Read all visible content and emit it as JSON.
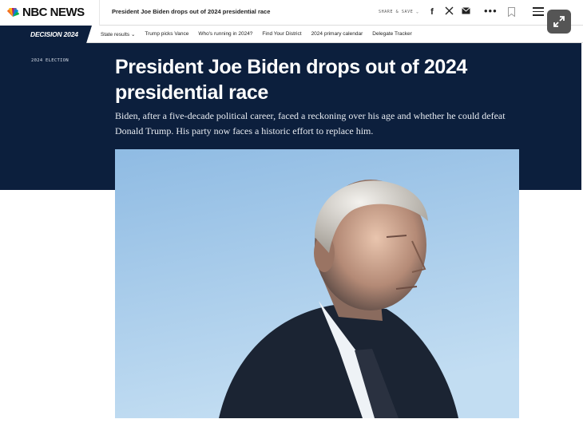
{
  "header": {
    "brand": "NBC NEWS",
    "mini_headline": "President Joe Biden drops out of 2024 presidential race",
    "share_label": "SHARE & SAVE",
    "icons": [
      "facebook-icon",
      "x-icon",
      "mail-icon",
      "more-icon",
      "bookmark-icon",
      "menu-icon",
      "expand-icon"
    ]
  },
  "subnav": {
    "decision_label": "DECISION 2024",
    "links": [
      "State results",
      "Trump picks Vance",
      "Who's running in 2024?",
      "Find Your District",
      "2024 primary calendar",
      "Delegate Tracker"
    ]
  },
  "article": {
    "eyebrow": "2024 ELECTION",
    "title": "President Joe Biden drops out of 2024 presidential race",
    "dek": "Biden, after a five-decade political career, faced a reckoning over his age and whether he could defeat Donald Trump. His party now faces a historic effort to replace him."
  },
  "colors": {
    "hero_bg": "#0c1f3d",
    "sky": "#9ec4e6"
  }
}
